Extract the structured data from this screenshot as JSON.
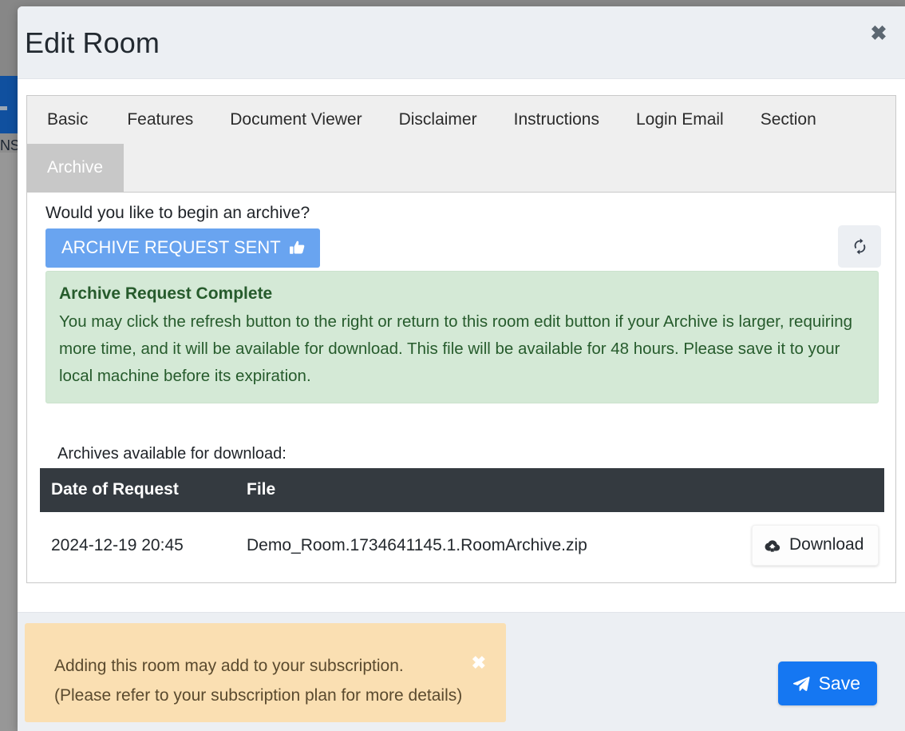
{
  "background": {
    "nav_text": "NS"
  },
  "modal": {
    "title": "Edit Room",
    "close_label": "✖"
  },
  "tabs": [
    {
      "label": "Basic",
      "active": false
    },
    {
      "label": "Features",
      "active": false
    },
    {
      "label": "Document Viewer",
      "active": false
    },
    {
      "label": "Disclaimer",
      "active": false
    },
    {
      "label": "Instructions",
      "active": false
    },
    {
      "label": "Login Email",
      "active": false
    },
    {
      "label": "Section",
      "active": false
    },
    {
      "label": "Archive",
      "active": true
    }
  ],
  "archive_panel": {
    "question": "Would you like to begin an archive?",
    "request_button_label": "ARCHIVE REQUEST SENT",
    "request_button_icon": "thumbs-up-icon",
    "request_button_color": "#69a4f0",
    "refresh_button_icon": "refresh-icon",
    "alert": {
      "title": "Archive Request Complete",
      "body": "You may click the refresh button to the right or return to this room edit button if your Archive is larger, requiring more time, and it will be available for download. This file will be available for 48 hours. Please save it to your local machine before its expiration.",
      "background_color": "#d4e9d6",
      "text_color": "#265b2c"
    },
    "table_caption": "Archives available for download:",
    "table": {
      "columns": [
        "Date of Request",
        "File",
        ""
      ],
      "header_background": "#343a40",
      "rows": [
        {
          "date": "2024-12-19 20:45",
          "file": "Demo_Room.1734641145.1.RoomArchive.zip",
          "action_label": "Download",
          "action_icon": "cloud-download-icon"
        }
      ]
    }
  },
  "footer": {
    "warning": {
      "line1": "Adding this room may add to your subscription.",
      "line2": "(Please refer to your subscription plan for more details)",
      "close_label": "✖",
      "background_color": "#fadfb2"
    },
    "save_label": "Save",
    "save_icon": "send-icon",
    "save_color": "#1577f2"
  }
}
